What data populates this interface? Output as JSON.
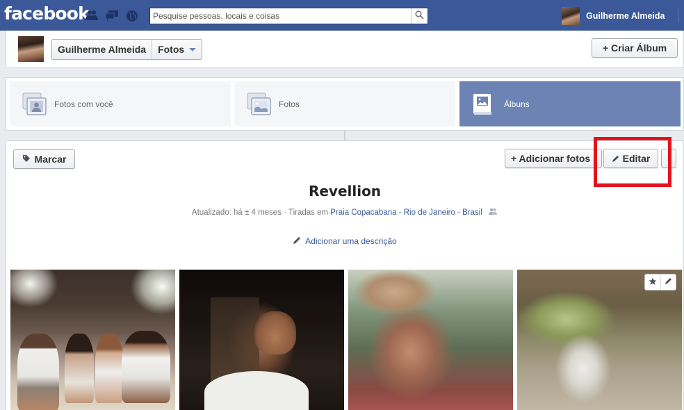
{
  "topbar": {
    "logo": "facebook",
    "search_placeholder": "Pesquise pessoas, locais e coisas",
    "user_name": "Guilherme Almeida",
    "jewels": [
      "friend-requests-icon",
      "messages-icon",
      "notifications-globe-icon"
    ],
    "colors": {
      "brand": "#3b5998"
    }
  },
  "header": {
    "breadcrumb_name": "Guilherme Almeida",
    "breadcrumb_section": "Fotos",
    "create_album_label": "+ Criar Álbum"
  },
  "tabs": [
    {
      "label": "Fotos com você",
      "icon": "tagged-photos-icon",
      "active": false
    },
    {
      "label": "Fotos",
      "icon": "photos-icon",
      "active": false
    },
    {
      "label": "Álbuns",
      "icon": "albums-icon",
      "active": true
    }
  ],
  "album": {
    "tag_button": "Marcar",
    "add_photos_button": "+ Adicionar fotos",
    "edit_button": "Editar",
    "more_button": "↕",
    "title": "Revellion",
    "meta_prefix": "Atualizado: há ± 4 meses · Tiradas em ",
    "location": "Praia Copacabana - Rio de Janeiro - Brasil",
    "add_description": "Adicionar uma descrição",
    "highlight_color": "#e3121d",
    "photos": [
      {
        "description": "Group of friends sitting on the beach at night"
      },
      {
        "description": "Smiling man with glasses at night event"
      },
      {
        "description": "Man with straw hat and glasses"
      },
      {
        "description": "Couple sitting on the sand"
      }
    ]
  }
}
